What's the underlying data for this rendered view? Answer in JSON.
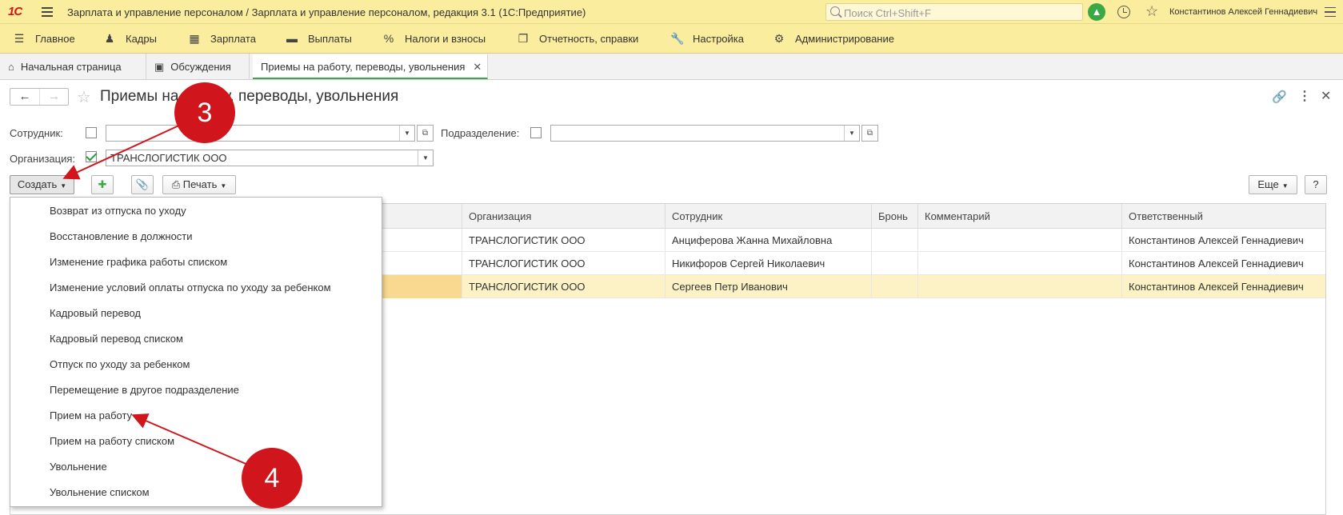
{
  "window": {
    "logo": "1С",
    "title": "Зарплата и управление персоналом / Зарплата и управление персоналом, редакция 3.1  (1С:Предприятие)",
    "search_placeholder": "Поиск Ctrl+Shift+F",
    "user": "Константинов Алексей Геннадиевич"
  },
  "sections": [
    {
      "label": "Главное",
      "icon": "menu-list-icon"
    },
    {
      "label": "Кадры",
      "icon": "people-icon"
    },
    {
      "label": "Зарплата",
      "icon": "calculator-icon"
    },
    {
      "label": "Выплаты",
      "icon": "wallet-icon"
    },
    {
      "label": "Налоги и взносы",
      "icon": "percent-icon"
    },
    {
      "label": "Отчетность, справки",
      "icon": "reports-icon"
    },
    {
      "label": "Настройка",
      "icon": "wrench-icon"
    },
    {
      "label": "Администрирование",
      "icon": "gear-icon"
    }
  ],
  "tabs": [
    {
      "label": "Начальная страница",
      "icon": "home-icon"
    },
    {
      "label": "Обсуждения",
      "icon": "chat-icon"
    },
    {
      "label": "Приемы на работу, переводы, увольнения",
      "icon": "close-icon"
    }
  ],
  "page": {
    "title": "Приемы на работу, переводы, увольнения"
  },
  "filters": {
    "employee_label": "Сотрудник:",
    "employee_value": "",
    "department_label": "Подразделение:",
    "department_value": "",
    "organization_label": "Организация:",
    "organization_value": "ТРАНСЛОГИСТИК ООО"
  },
  "toolbar": {
    "create": "Создать",
    "print": "Печать",
    "more": "Еще",
    "help": "?"
  },
  "table": {
    "columns": [
      "Организация",
      "Сотрудник",
      "Бронь",
      "Комментарий",
      "Ответственный"
    ],
    "rows": [
      {
        "org": "ТРАНСЛОГИСТИК ООО",
        "employee": "Анциферова Жанна Михайловна",
        "reserve": "",
        "comment": "",
        "responsible": "Константинов Алексей Геннадиевич"
      },
      {
        "org": "ТРАНСЛОГИСТИК ООО",
        "employee": "Никифоров Сергей Николаевич",
        "reserve": "",
        "comment": "",
        "responsible": "Константинов Алексей Геннадиевич"
      },
      {
        "org": "ТРАНСЛОГИСТИК ООО",
        "employee": "Сергеев Петр Иванович",
        "reserve": "",
        "comment": "",
        "responsible": "Константинов Алексей Геннадиевич"
      }
    ]
  },
  "create_menu": [
    "Возврат из отпуска по уходу",
    "Восстановление в должности",
    "Изменение графика работы списком",
    "Изменение условий оплаты отпуска по уходу за ребенком",
    "Кадровый перевод",
    "Кадровый перевод списком",
    "Отпуск по уходу за ребенком",
    "Перемещение в другое подразделение",
    "Прием на работу",
    "Прием на работу списком",
    "Увольнение",
    "Увольнение списком"
  ],
  "annotations": {
    "step3": "3",
    "step4": "4",
    "color": "#d0161c"
  },
  "colors": {
    "header_bg": "#fbed9e",
    "accent_green": "#3aa845",
    "selected_row": "#fdf1c6"
  }
}
